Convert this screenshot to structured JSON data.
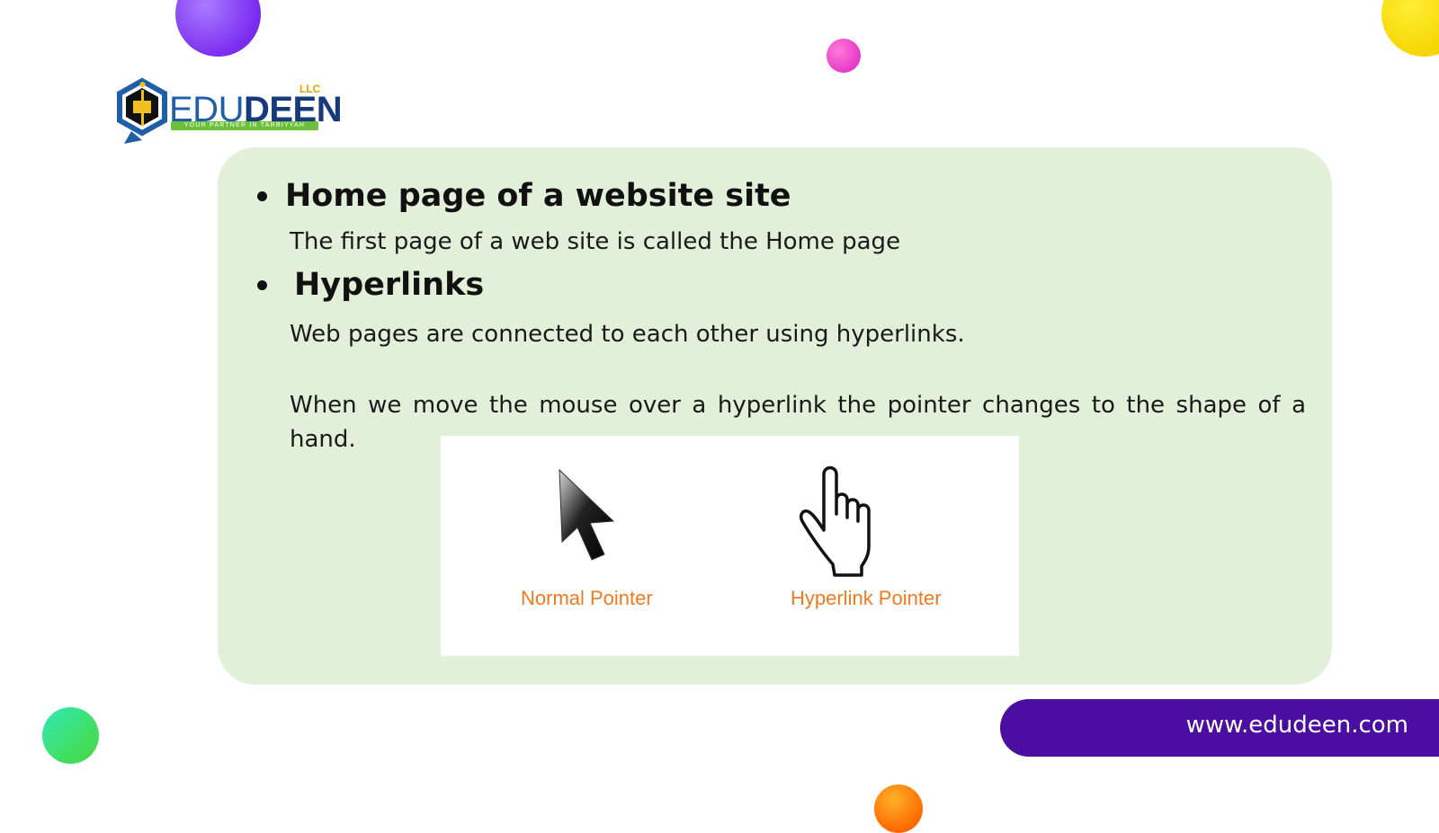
{
  "logo": {
    "text_edu": "EDU",
    "text_deen": "DEEN",
    "llc": "LLC",
    "tagline": "YOUR PARTNER IN TARBIYYAH",
    "icon": "hexagon-book-icon"
  },
  "slide": {
    "section1": {
      "heading": "Home page of a website site",
      "body": "The first page of a web site is called the Home page"
    },
    "section2": {
      "heading": "Hyperlinks",
      "body1": "Web pages are connected to each other using hyperlinks.",
      "body2": "When we move the mouse over a hyperlink the pointer changes to the shape of a hand."
    },
    "image": {
      "normal_label": "Normal Pointer",
      "hyperlink_label": "Hyperlink Pointer",
      "normal_icon": "arrow-cursor-icon",
      "hyperlink_icon": "hand-cursor-icon"
    }
  },
  "footer": {
    "url": "www.edudeen.com"
  },
  "colors": {
    "panel": "#e3f0d9",
    "url_bar": "#4a0fa0",
    "label_orange": "#f07a1e",
    "purple_dot": "#7a2cf0",
    "pink_dot": "#e53bc8",
    "yellow_dot": "#f5d400",
    "green_dot": "#3fe06e",
    "orange_dot": "#ff6a00"
  }
}
